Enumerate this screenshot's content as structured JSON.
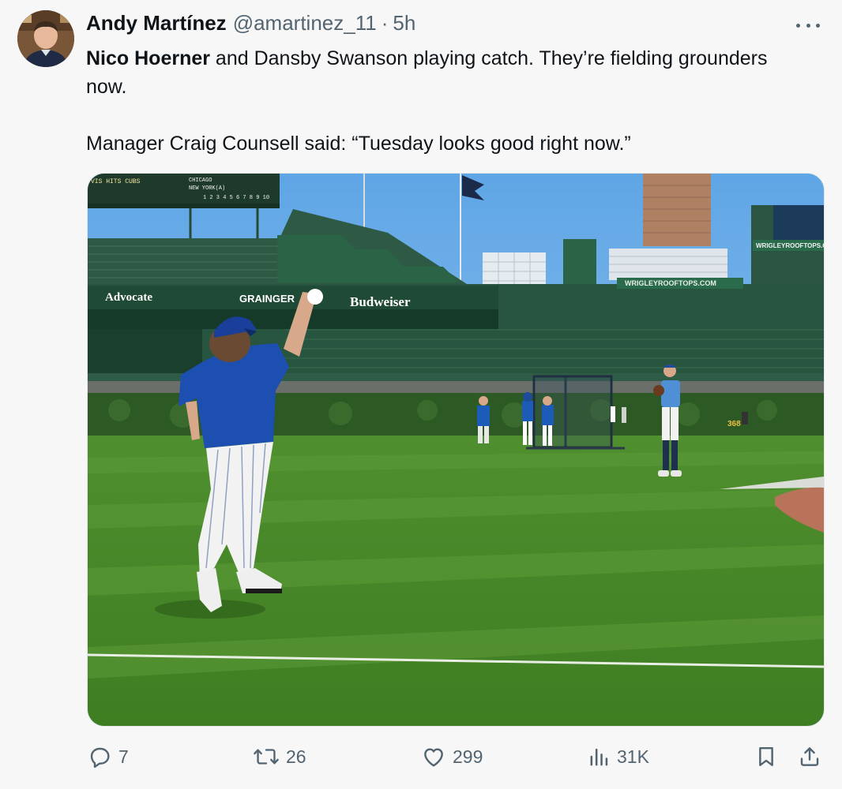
{
  "tweet": {
    "author": {
      "name": "Andy Martínez",
      "handle": "@amartinez_11",
      "separator": "·",
      "time": "5h"
    },
    "text": {
      "mention": "Nico Hoerner",
      "line1_rest": " and Dansby Swanson playing catch. They’re fielding grounders now.",
      "line2": "Manager Craig Counsell said: “Tuesday looks good right now.”"
    },
    "photo_signage": {
      "scoreboard_left": "VIS HITS CUBS",
      "scoreboard_city": "CHICAGO",
      "scoreboard_opponent": "NEW YORK(A)",
      "scoreboard_innings": "1 2 3 4 5 6 7 8 9 10",
      "advocate": "Advocate",
      "grainger": "GRAINGER",
      "budweiser": "Budweiser",
      "wrigley_right": "WRIGLEYROOFTOPS.COM",
      "wrigley_mid": "WRIGLEYROOFTOPS.COM",
      "wall_number": "368"
    },
    "metrics": {
      "replies": "7",
      "reposts": "26",
      "likes": "299",
      "views": "31K"
    },
    "icons": {
      "reply": "reply-icon",
      "repost": "repost-icon",
      "like": "like-icon",
      "views": "views-icon",
      "bookmark": "bookmark-icon",
      "share": "share-icon",
      "more": "more-icon"
    },
    "colors": {
      "text_primary": "#0f1419",
      "text_secondary": "#536471",
      "background": "#f7f7f7"
    }
  }
}
